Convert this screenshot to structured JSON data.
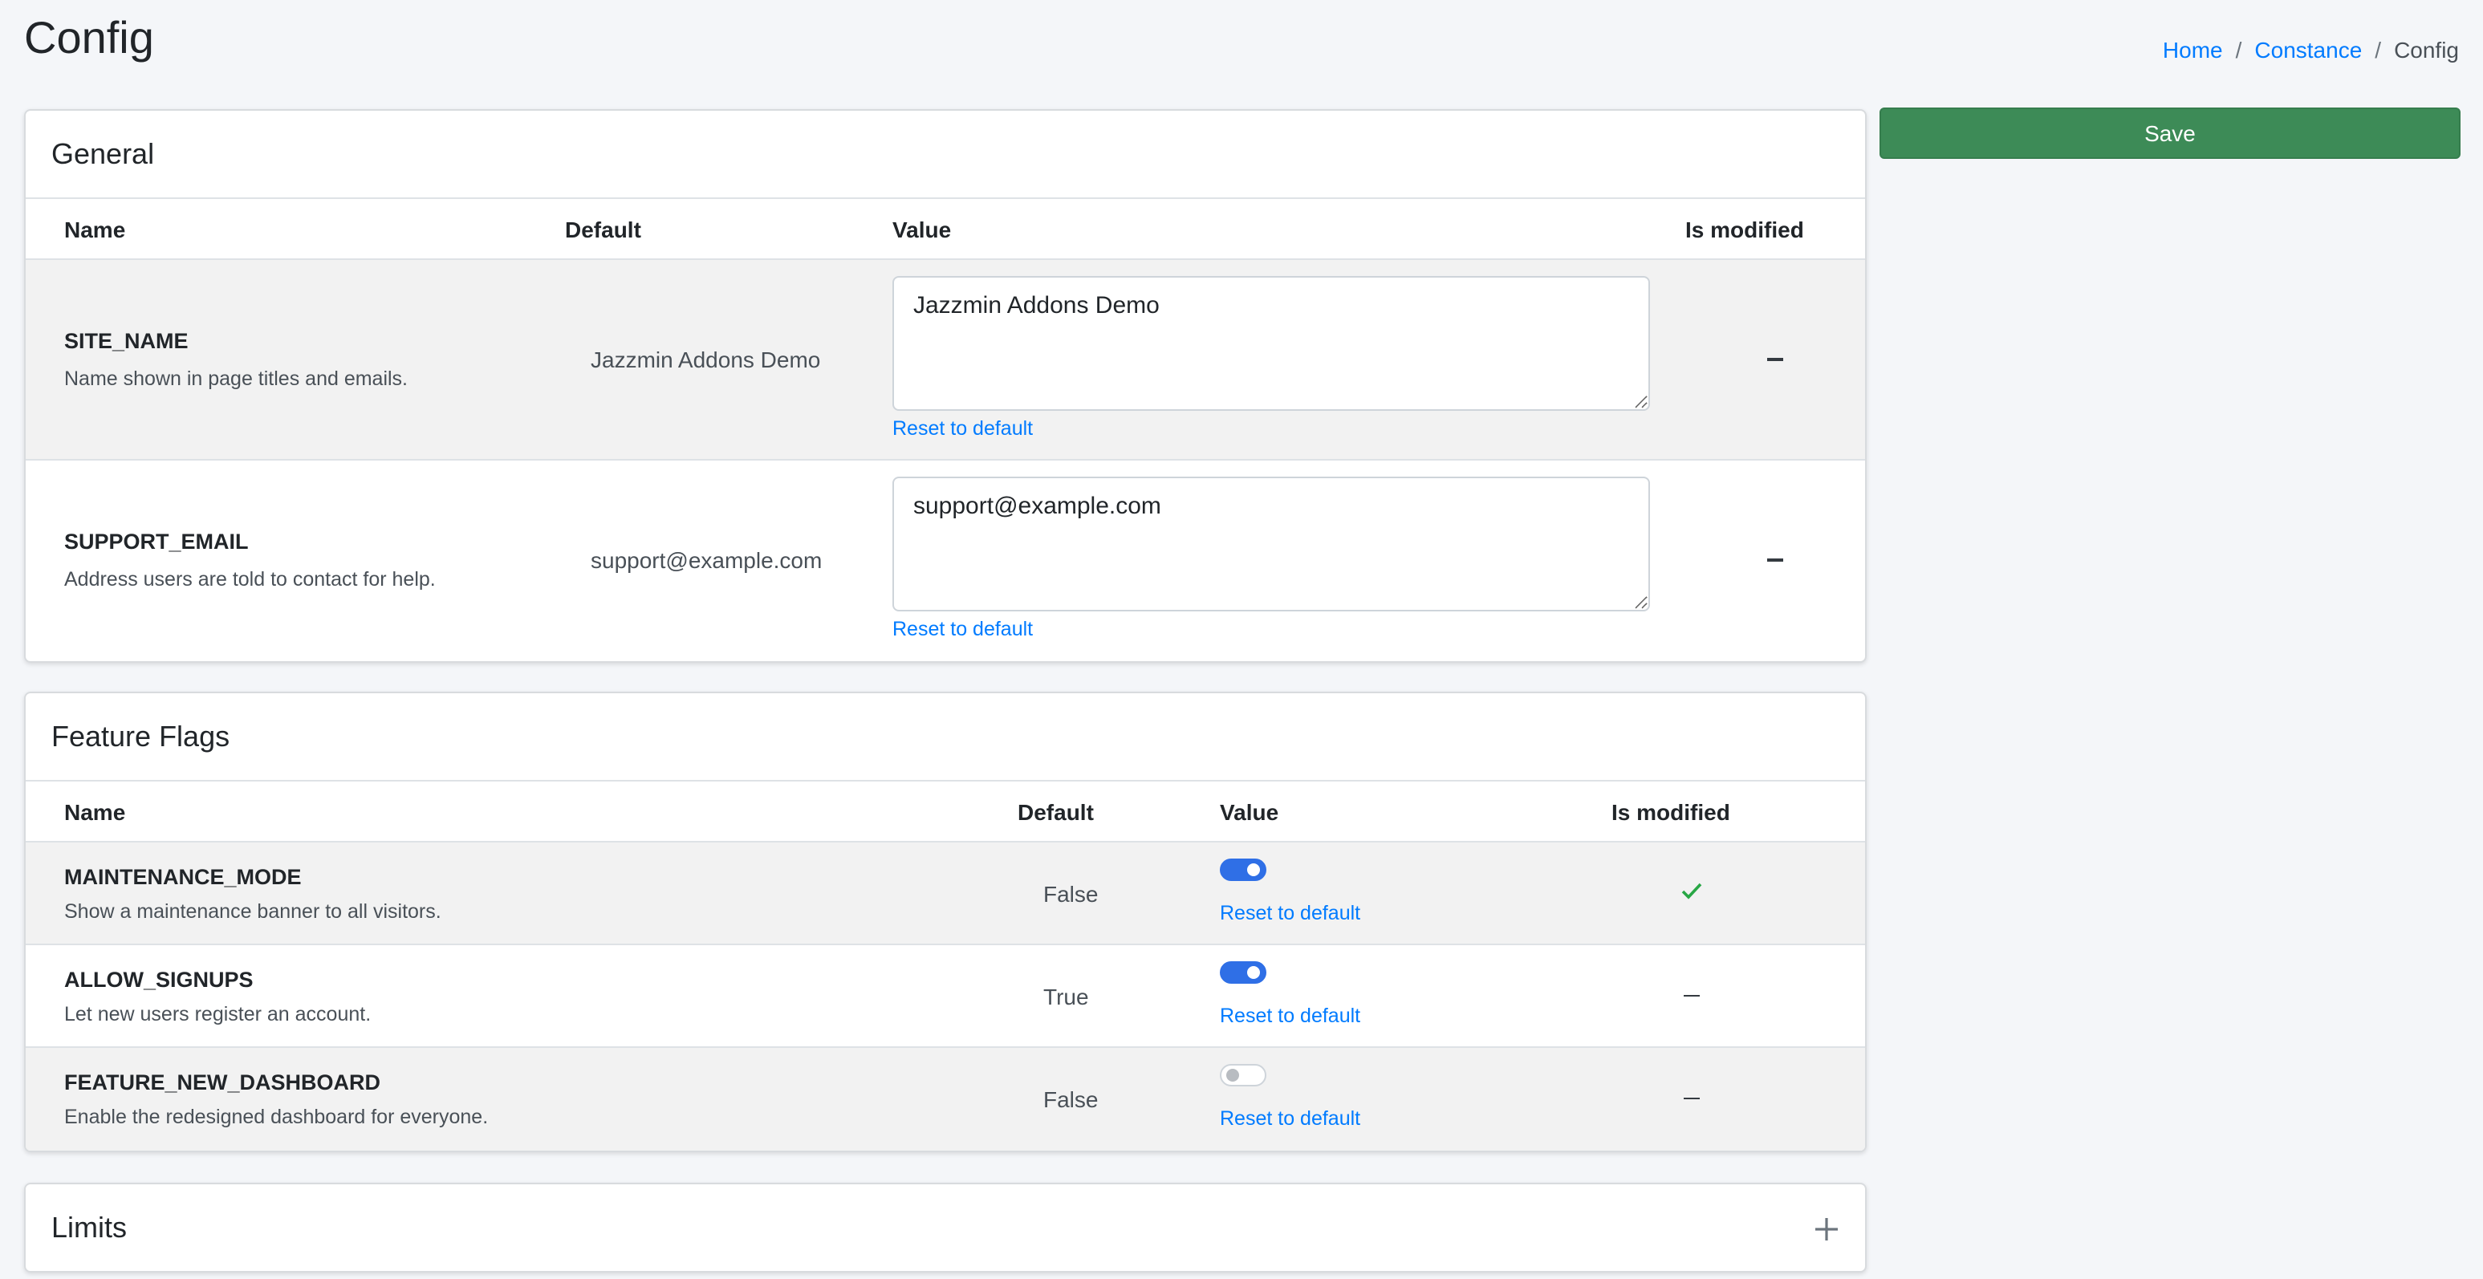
{
  "page": {
    "title": "Config"
  },
  "breadcrumb": {
    "items": [
      "Home",
      "Constance"
    ],
    "separator": "/",
    "current": "Config"
  },
  "actions": {
    "save_label": "Save"
  },
  "general": {
    "title": "General",
    "columns": {
      "name": "Name",
      "default": "Default",
      "value": "Value",
      "modified": "Is modified"
    },
    "rows": [
      {
        "name": "SITE_NAME",
        "help": "Name shown in page titles and emails.",
        "default": "Jazzmin Addons Demo",
        "value": "Jazzmin Addons Demo",
        "reset": "Reset to default",
        "modified_icon": "dash-icon"
      },
      {
        "name": "SUPPORT_EMAIL",
        "help": "Address users are told to contact for help.",
        "default": "support@example.com",
        "value": "support@example.com",
        "reset": "Reset to default",
        "modified_icon": "dash-icon"
      }
    ]
  },
  "feature_flags": {
    "title": "Feature Flags",
    "columns": {
      "name": "Name",
      "default": "Default",
      "value": "Value",
      "modified": "Is modified"
    },
    "rows": [
      {
        "name": "MAINTENANCE_MODE",
        "help": "Show a maintenance banner to all visitors.",
        "default": "False",
        "value_on": true,
        "reset": "Reset to default",
        "modified_icon": "check-icon"
      },
      {
        "name": "ALLOW_SIGNUPS",
        "help": "Let new users register an account.",
        "default": "True",
        "value_on": true,
        "reset": "Reset to default",
        "modified_icon": "dash-icon"
      },
      {
        "name": "FEATURE_NEW_DASHBOARD",
        "help": "Enable the redesigned dashboard for everyone.",
        "default": "False",
        "value_on": false,
        "reset": "Reset to default",
        "modified_icon": "dash-icon"
      }
    ]
  },
  "limits": {
    "title": "Limits",
    "collapsed": true
  },
  "colors": {
    "save": "#3d8b57",
    "link": "#007bff",
    "toggle_on": "#2f6fe6",
    "check": "#28a745"
  }
}
